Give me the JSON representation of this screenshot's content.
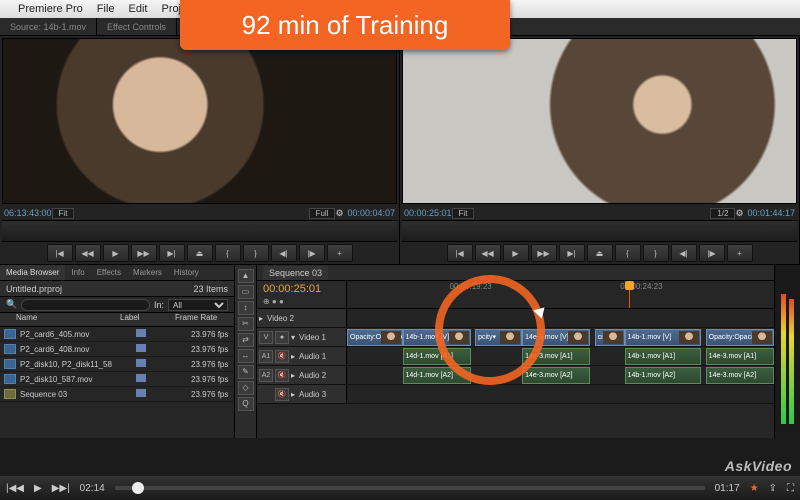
{
  "menubar": {
    "apple": "",
    "items": [
      "Premiere Pro",
      "File",
      "Edit",
      "Proj"
    ]
  },
  "banner": "92 min of Training",
  "tabs": {
    "source": "Source: 14b-1.mov",
    "effects": "Effect Controls"
  },
  "source": {
    "tc_left": "06:13:43:00",
    "fit": "Fit",
    "full": "Full",
    "tc_right": "00:00:04:07"
  },
  "program": {
    "tc_left": "00:00:25:01",
    "half": "1/2",
    "tc_right": "00:01:44:17"
  },
  "transport": [
    "|◀",
    "◀◀",
    "▶",
    "▶▶",
    "▶|",
    "⏏",
    "{",
    "}",
    "◀|",
    "|▶",
    "+"
  ],
  "project": {
    "tabs": [
      "Media Browser",
      "Info",
      "Effects",
      "Markers",
      "History"
    ],
    "title": "Untitled.prproj",
    "count": "23 Items",
    "filter": {
      "p": "",
      "in_label": "In:",
      "in_val": "All"
    },
    "cols": {
      "name": "Name",
      "label": "Label",
      "fr": "Frame Rate"
    },
    "items": [
      {
        "name": "P2_card6_405.mov",
        "fr": "23.976 fps",
        "type": "mov"
      },
      {
        "name": "P2_card6_408.mov",
        "fr": "23.976 fps",
        "type": "mov"
      },
      {
        "name": "P2_disk10, P2_disk11_58",
        "fr": "23.976 fps",
        "type": "mov"
      },
      {
        "name": "P2_disk10_587.mov",
        "fr": "23.976 fps",
        "type": "mov"
      },
      {
        "name": "Sequence 03",
        "fr": "23.976 fps",
        "type": "seq"
      }
    ]
  },
  "tools": [
    "▲",
    "▭",
    "↕",
    "✂",
    "⇄",
    "↔",
    "✎",
    "◇",
    "Q"
  ],
  "timeline": {
    "seqname": "Sequence 03",
    "tc": "00:00:25:01",
    "ruler": [
      "00:00:19:23",
      "00:00:24:23"
    ],
    "tracks": {
      "v2": "Video 2",
      "v1": "Video 1",
      "a1": "Audio 1",
      "a2": "Audio 2",
      "a3": "Audio 3",
      "lock": "V",
      "m": "M",
      "s": "S",
      "a": "A1",
      "a_2": "A2"
    },
    "clips": {
      "v1": [
        {
          "l": 0,
          "w": 13,
          "t": "Opacity:Opacity▾"
        },
        {
          "l": 13,
          "w": 16,
          "t": "14b-1.mov [V]"
        },
        {
          "l": 30,
          "w": 11,
          "t": "pcity▾"
        },
        {
          "l": 41,
          "w": 16,
          "t": "14e-3.mov [V]"
        },
        {
          "l": 58,
          "w": 7,
          "t": "city▾"
        },
        {
          "l": 65,
          "w": 18,
          "t": "14b-1.mov [V]"
        },
        {
          "l": 84,
          "w": 16,
          "t": "Opacity:Opacity▾"
        }
      ],
      "a1": [
        {
          "l": 13,
          "w": 16,
          "t": "14d-1.mov [A1]"
        },
        {
          "l": 41,
          "w": 16,
          "t": "14e-3.mov [A1]"
        },
        {
          "l": 65,
          "w": 18,
          "t": "14b-1.mov [A1]"
        },
        {
          "l": 84,
          "w": 16,
          "t": "14e-3.mov [A1]"
        }
      ],
      "a2": [
        {
          "l": 13,
          "w": 16,
          "t": "14d-1.mov [A2]"
        },
        {
          "l": 41,
          "w": 16,
          "t": "14e-3.mov [A2]"
        },
        {
          "l": 65,
          "w": 18,
          "t": "14b-1.mov [A2]"
        },
        {
          "l": 84,
          "w": 16,
          "t": "14e-3.mov [A2]"
        }
      ]
    }
  },
  "player": {
    "cur": "02:14",
    "dur": "01:17",
    "prog_pct": 3
  },
  "watermark": "AskVideo"
}
